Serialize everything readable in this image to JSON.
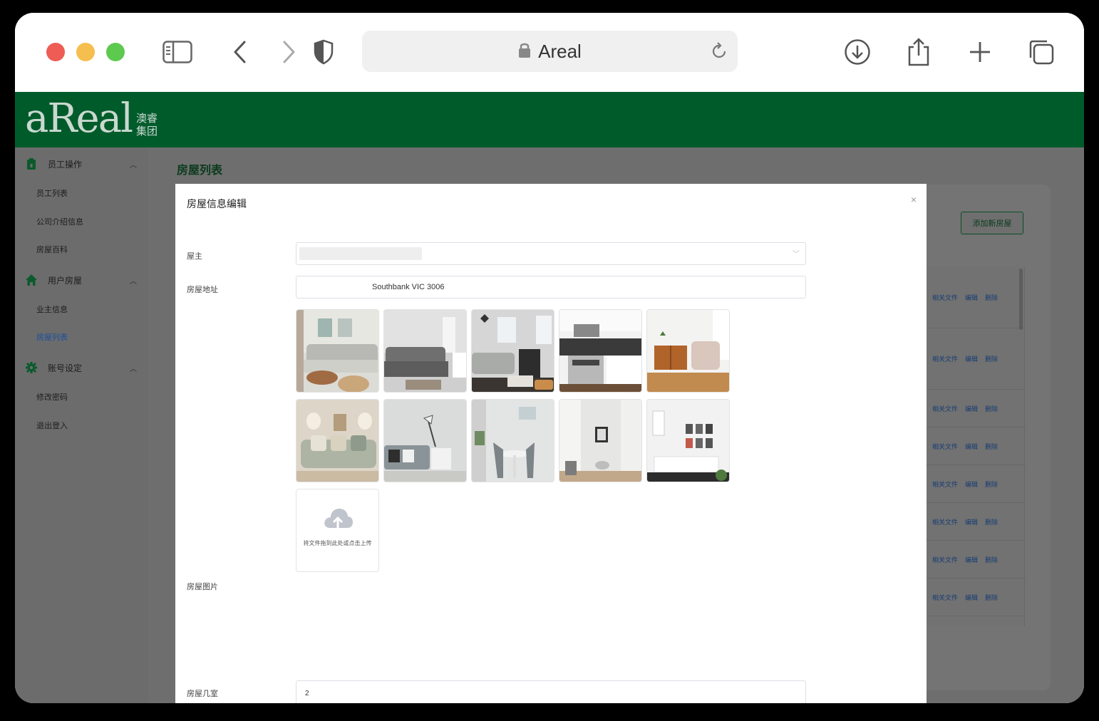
{
  "browser": {
    "url_text": "Areal"
  },
  "brand": {
    "logo_word": "aReal",
    "logo_cn_top": "澳睿",
    "logo_cn_bottom": "集团",
    "primary_color": "#005b2b"
  },
  "sidebar": {
    "groups": [
      {
        "label": "员工操作",
        "icon": "clipboard-icon",
        "items": [
          "员工列表",
          "公司介绍信息",
          "房屋百科"
        ]
      },
      {
        "label": "用户房屋",
        "icon": "home-icon",
        "items": [
          "业主信息",
          "房屋列表"
        ]
      },
      {
        "label": "账号设定",
        "icon": "gear-icon",
        "items": [
          "修改密码",
          "退出登入"
        ]
      }
    ],
    "active_item": "房屋列表"
  },
  "main": {
    "page_title": "房屋列表",
    "add_button": "添加新房屋",
    "row_actions": {
      "files": "相关文件",
      "edit": "编辑",
      "delete": "删除"
    }
  },
  "modal": {
    "title": "房屋信息编辑",
    "close": "×",
    "fields": {
      "owner_label": "屋主",
      "address_label": "房屋地址",
      "address_value": "Southbank VIC 3006",
      "photos_label": "房屋图片",
      "upload_text": "将文件拖到此处或点击上传",
      "rooms_label": "房屋几室",
      "rooms_value": "2"
    }
  }
}
